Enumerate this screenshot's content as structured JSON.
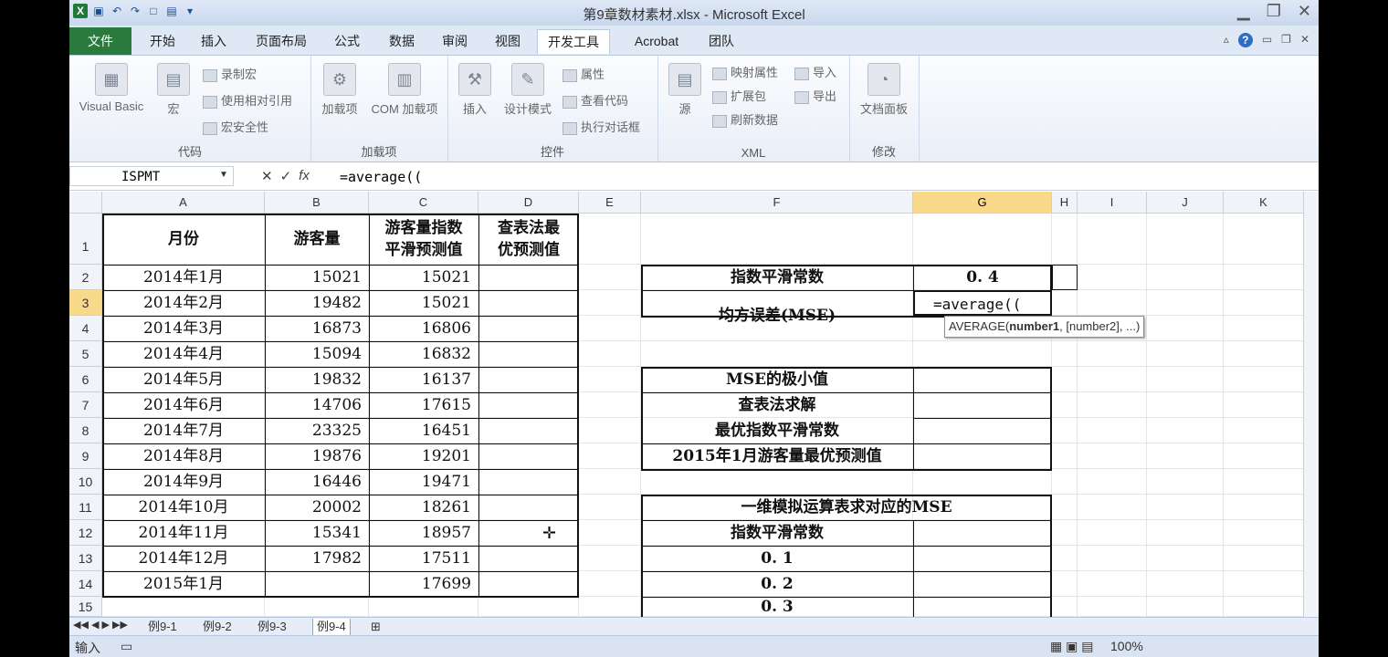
{
  "window": {
    "title": "第9章数材素材.xlsx - Microsoft Excel"
  },
  "tabs": {
    "file": "文件",
    "home": "开始",
    "insert": "插入",
    "layout": "页面布局",
    "formulas": "公式",
    "data": "数据",
    "review": "审阅",
    "view": "视图",
    "developer": "开发工具",
    "acrobat": "Acrobat",
    "team": "团队"
  },
  "ribbon": {
    "code": {
      "label": "代码",
      "vb": "Visual Basic",
      "macro": "宏",
      "record": "录制宏",
      "relative": "使用相对引用",
      "security": "宏安全性"
    },
    "addins": {
      "label": "加载项",
      "addin": "加载项",
      "com": "COM 加载项"
    },
    "controls": {
      "label": "控件",
      "insert": "插入",
      "design": "设计模式",
      "props": "属性",
      "viewcode": "查看代码",
      "dialog": "执行对话框"
    },
    "xml": {
      "label": "XML",
      "source": "源",
      "mapprops": "映射属性",
      "expand": "扩展包",
      "refresh": "刷新数据",
      "import": "导入",
      "export": "导出"
    },
    "modify": {
      "label": "修改",
      "docpanel": "文档面板"
    }
  },
  "formula_bar": {
    "name_box": "ISPMT",
    "formula": "=average(("
  },
  "columns": [
    "A",
    "B",
    "C",
    "D",
    "E",
    "F",
    "G",
    "H",
    "I",
    "J",
    "K"
  ],
  "rows": [
    "1",
    "2",
    "3",
    "4",
    "5",
    "6",
    "7",
    "8",
    "9",
    "10",
    "11",
    "12",
    "13",
    "14",
    "15"
  ],
  "table1": {
    "headers": {
      "a": "月份",
      "b": "游客量",
      "c1": "游客量指数",
      "c2": "平滑预测值",
      "d1": "查表法最",
      "d2": "优预测值"
    },
    "data": [
      {
        "month": "2014年1月",
        "visitors": "15021",
        "forecast": "15021"
      },
      {
        "month": "2014年2月",
        "visitors": "19482",
        "forecast": "15021"
      },
      {
        "month": "2014年3月",
        "visitors": "16873",
        "forecast": "16806"
      },
      {
        "month": "2014年4月",
        "visitors": "15094",
        "forecast": "16832"
      },
      {
        "month": "2014年5月",
        "visitors": "19832",
        "forecast": "16137"
      },
      {
        "month": "2014年6月",
        "visitors": "14706",
        "forecast": "17615"
      },
      {
        "month": "2014年7月",
        "visitors": "23325",
        "forecast": "16451"
      },
      {
        "month": "2014年8月",
        "visitors": "19876",
        "forecast": "19201"
      },
      {
        "month": "2014年9月",
        "visitors": "16446",
        "forecast": "19471"
      },
      {
        "month": "2014年10月",
        "visitors": "20002",
        "forecast": "18261"
      },
      {
        "month": "2014年11月",
        "visitors": "15341",
        "forecast": "18957"
      },
      {
        "month": "2014年12月",
        "visitors": "17982",
        "forecast": "17511"
      },
      {
        "month": "2015年1月",
        "visitors": "",
        "forecast": "17699"
      }
    ]
  },
  "table2": {
    "smoothing_label": "指数平滑常数",
    "smoothing_value": "0. 4",
    "mse_label": "均方误差(MSE)",
    "edit_value": "=average((",
    "tooltip": "AVERAGE(number1, [number2], ...)",
    "tooltip_fn": "AVERAGE(",
    "tooltip_bold": "number1",
    "tooltip_rest": ", [number2], ...)"
  },
  "table3": {
    "min_mse": "MSE的极小值",
    "lookup1": "查表法求解",
    "lookup2": "最优指数平滑常数",
    "best_forecast": "2015年1月游客量最优预测值"
  },
  "table4": {
    "title": "一维模拟运算表求对应的MSE",
    "header": "指数平滑常数",
    "values": [
      "0. 1",
      "0. 2",
      "0. 3"
    ]
  },
  "sheets": [
    "例9-1",
    "例9-2",
    "例9-3",
    "例9-4"
  ],
  "status": {
    "mode": "输入",
    "zoom": "100%"
  }
}
